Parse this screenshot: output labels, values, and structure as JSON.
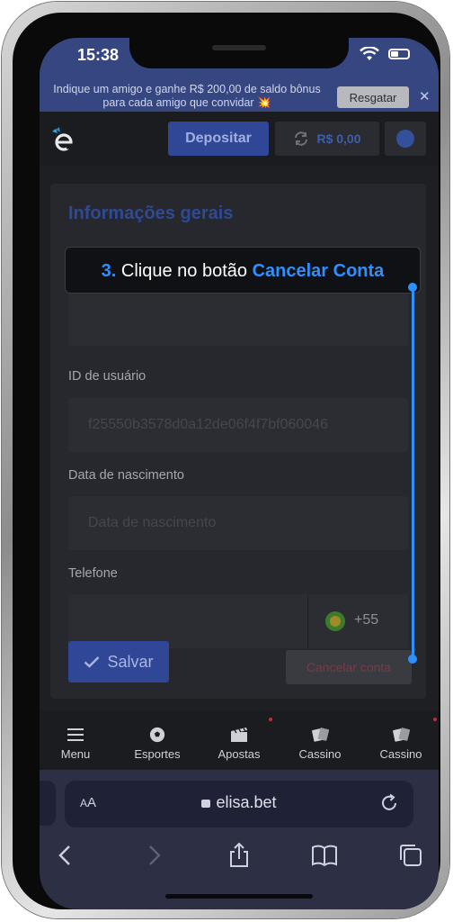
{
  "status_bar": {
    "time": "15:38"
  },
  "promo_banner": {
    "text": "Indique um amigo e ganhe R$ 200,00 de saldo bônus para cada amigo que convidar 💥",
    "redeem_label": "Resgatar",
    "close_symbol": "✕"
  },
  "header": {
    "deposit_label": "Depositar",
    "balance": "R$ 0,00",
    "icons": [
      "logo-icon",
      "refresh-icon",
      "avatar-icon"
    ]
  },
  "form": {
    "title": "Informações gerais",
    "user_id_label": "ID de usuário",
    "user_id_value": "f25550b3578d0a12de06f4f7bf060046",
    "birthdate_label": "Data de nascimento",
    "birthdate_placeholder": "Data de nascimento",
    "phone_label": "Telefone",
    "phone_code": "+55",
    "save_label": "Salvar",
    "cancel_account_label": "Cancelar conta"
  },
  "tutorial": {
    "step": "3.",
    "text": "Clique no botão",
    "highlight": "Cancelar Conta",
    "accent_color": "#2e8fff"
  },
  "bottom_nav": {
    "items": [
      {
        "label": "Menu",
        "icon": "menu-icon"
      },
      {
        "label": "Esportes",
        "icon": "soccer-ball-icon"
      },
      {
        "label": "Apostas",
        "icon": "clapper-icon"
      },
      {
        "label": "Cassino",
        "icon": "cards-icon"
      },
      {
        "label": "Cassino",
        "icon": "cards-icon"
      }
    ]
  },
  "browser": {
    "text_size_small": "A",
    "text_size_large": "A",
    "url": "elisa.bet",
    "icons": [
      "back-icon",
      "forward-icon",
      "share-icon",
      "bookmarks-icon",
      "tabs-icon"
    ]
  }
}
